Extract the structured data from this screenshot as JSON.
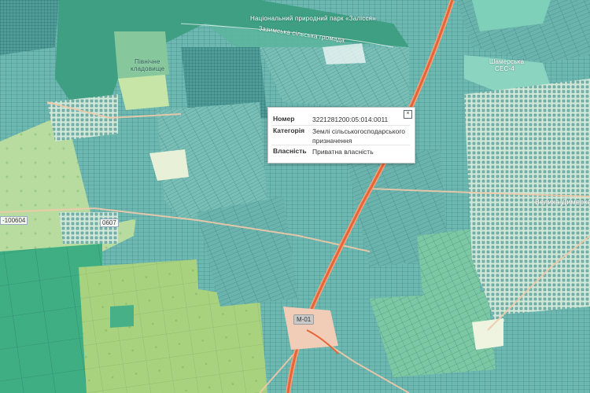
{
  "labels": {
    "park": "Національний природний парк «Залісся»",
    "hromada": "Зазимська сільська громада",
    "cemetery_line1": "Північне",
    "cemetery_line2": "кладовище",
    "substation_line1": "Шамерська",
    "substation_line2": "СЕС-4",
    "village": "Велика Димерка",
    "road_m01": "М-01",
    "cadastre_left": "-100604",
    "cadastre_mid": "0607"
  },
  "popup": {
    "rows": [
      {
        "key": "Номер",
        "value": "3221281200:05:014:0011"
      },
      {
        "key": "Категорія",
        "value": "Землі сільськогосподарського призначення"
      },
      {
        "key": "Власність",
        "value": "Приватна власність"
      }
    ],
    "close_label": "×"
  },
  "colors": {
    "teal_parcel": "#6fb7b0",
    "forest": "#4a9f7f",
    "light_green": "#a6d07b",
    "pale_green": "#c8e4b4",
    "built_up": "#d7ead4",
    "parcel_line": "#2f6f73",
    "road_main": "#e5653a",
    "road_minor": "#f1c9a8"
  },
  "icons": {
    "close": "close-icon"
  }
}
